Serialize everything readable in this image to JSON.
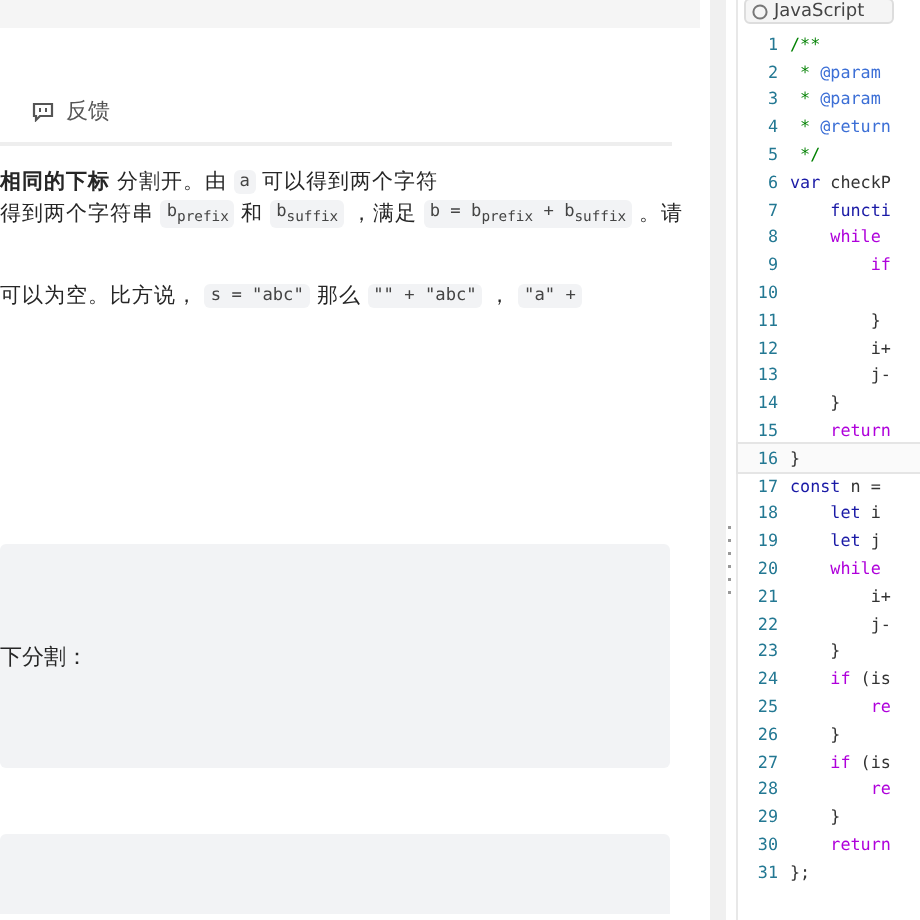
{
  "feedback": {
    "label": "反馈"
  },
  "description": [
    [
      {
        "kind": "bold",
        "text": "相同的下标"
      },
      {
        "kind": "text",
        "text": " 分割开。由 "
      },
      {
        "kind": "code",
        "text": "a"
      },
      {
        "kind": "text",
        "text": " 可以得到两个字符"
      }
    ],
    [
      {
        "kind": "text",
        "text": "得到两个字符串 "
      },
      {
        "kind": "code",
        "text": "b$_{prefix}$"
      },
      {
        "kind": "text",
        "text": " 和 "
      },
      {
        "kind": "code",
        "text": "b$_{suffix}$"
      },
      {
        "kind": "text",
        "text": " ，满足 "
      },
      {
        "kind": "code",
        "text": "b = b$_{prefix}$ + b$_{suffix}$"
      },
      {
        "kind": "text",
        "text": " 。请"
      }
    ],
    [
      {
        "kind": "text",
        "text": "可以为空。比方说， "
      },
      {
        "kind": "code",
        "text": "s = \"abc\""
      },
      {
        "kind": "text",
        "text": " 那么 "
      },
      {
        "kind": "code",
        "text": "\"\" + \"abc\""
      },
      {
        "kind": "text",
        "text": " ， "
      },
      {
        "kind": "code",
        "text": "\"a\" +"
      }
    ]
  ],
  "example_1": {
    "text": "下分割："
  },
  "editor": {
    "language": "JavaScript",
    "lines": [
      {
        "number": "1",
        "tokens": [
          {
            "kind": "comment",
            "text": "/**"
          }
        ]
      },
      {
        "number": "2",
        "tokens": [
          {
            "kind": "comment",
            "text": " * "
          },
          {
            "kind": "tag",
            "text": "@param"
          }
        ]
      },
      {
        "number": "3",
        "tokens": [
          {
            "kind": "comment",
            "text": " * "
          },
          {
            "kind": "tag",
            "text": "@param"
          }
        ]
      },
      {
        "number": "4",
        "tokens": [
          {
            "kind": "comment",
            "text": " * "
          },
          {
            "kind": "tag",
            "text": "@return"
          }
        ]
      },
      {
        "number": "5",
        "tokens": [
          {
            "kind": "comment",
            "text": " */"
          }
        ]
      },
      {
        "number": "6",
        "tokens": [
          {
            "kind": "keyword",
            "text": "var"
          },
          {
            "kind": "plain",
            "text": " checkP"
          }
        ]
      },
      {
        "number": "7",
        "tokens": [
          {
            "kind": "keyword",
            "text": "    functi"
          }
        ]
      },
      {
        "number": "8",
        "tokens": [
          {
            "kind": "control",
            "text": "    while"
          }
        ]
      },
      {
        "number": "9",
        "tokens": [
          {
            "kind": "control",
            "text": "        if"
          }
        ]
      },
      {
        "number": "10"
      },
      {
        "number": "11",
        "tokens": [
          {
            "kind": "plain",
            "text": "        }"
          }
        ]
      },
      {
        "number": "12",
        "tokens": [
          {
            "kind": "plain",
            "text": "        i+"
          }
        ]
      },
      {
        "number": "13",
        "tokens": [
          {
            "kind": "plain",
            "text": "        j-"
          }
        ]
      },
      {
        "number": "14",
        "tokens": [
          {
            "kind": "plain",
            "text": "    }"
          }
        ]
      },
      {
        "number": "15",
        "tokens": [
          {
            "kind": "control",
            "text": "    return"
          }
        ]
      },
      {
        "number": "16",
        "current": true,
        "tokens": [
          {
            "kind": "plain",
            "text": "}"
          }
        ]
      },
      {
        "number": "17",
        "tokens": [
          {
            "kind": "keyword",
            "text": "const"
          },
          {
            "kind": "plain",
            "text": " n = "
          }
        ]
      },
      {
        "number": "18",
        "tokens": [
          {
            "kind": "keyword",
            "text": "    let"
          },
          {
            "kind": "plain",
            "text": " i"
          }
        ]
      },
      {
        "number": "19",
        "tokens": [
          {
            "kind": "keyword",
            "text": "    let"
          },
          {
            "kind": "plain",
            "text": " j"
          }
        ]
      },
      {
        "number": "20",
        "tokens": [
          {
            "kind": "control",
            "text": "    while"
          }
        ]
      },
      {
        "number": "21",
        "tokens": [
          {
            "kind": "plain",
            "text": "        i+"
          }
        ]
      },
      {
        "number": "22",
        "tokens": [
          {
            "kind": "plain",
            "text": "        j-"
          }
        ]
      },
      {
        "number": "23",
        "tokens": [
          {
            "kind": "plain",
            "text": "    }"
          }
        ]
      },
      {
        "number": "24",
        "tokens": [
          {
            "kind": "control",
            "text": "    if"
          },
          {
            "kind": "plain",
            "text": " (is"
          }
        ]
      },
      {
        "number": "25",
        "tokens": [
          {
            "kind": "control",
            "text": "        re"
          }
        ]
      },
      {
        "number": "26",
        "tokens": [
          {
            "kind": "plain",
            "text": "    }"
          }
        ]
      },
      {
        "number": "27",
        "tokens": [
          {
            "kind": "control",
            "text": "    if"
          },
          {
            "kind": "plain",
            "text": " (is"
          }
        ]
      },
      {
        "number": "28",
        "tokens": [
          {
            "kind": "control",
            "text": "        re"
          }
        ]
      },
      {
        "number": "29",
        "tokens": [
          {
            "kind": "plain",
            "text": "    }"
          }
        ]
      },
      {
        "number": "30",
        "tokens": [
          {
            "kind": "control",
            "text": "    return"
          }
        ]
      },
      {
        "number": "31",
        "tokens": [
          {
            "kind": "plain",
            "text": "};"
          }
        ]
      }
    ]
  }
}
